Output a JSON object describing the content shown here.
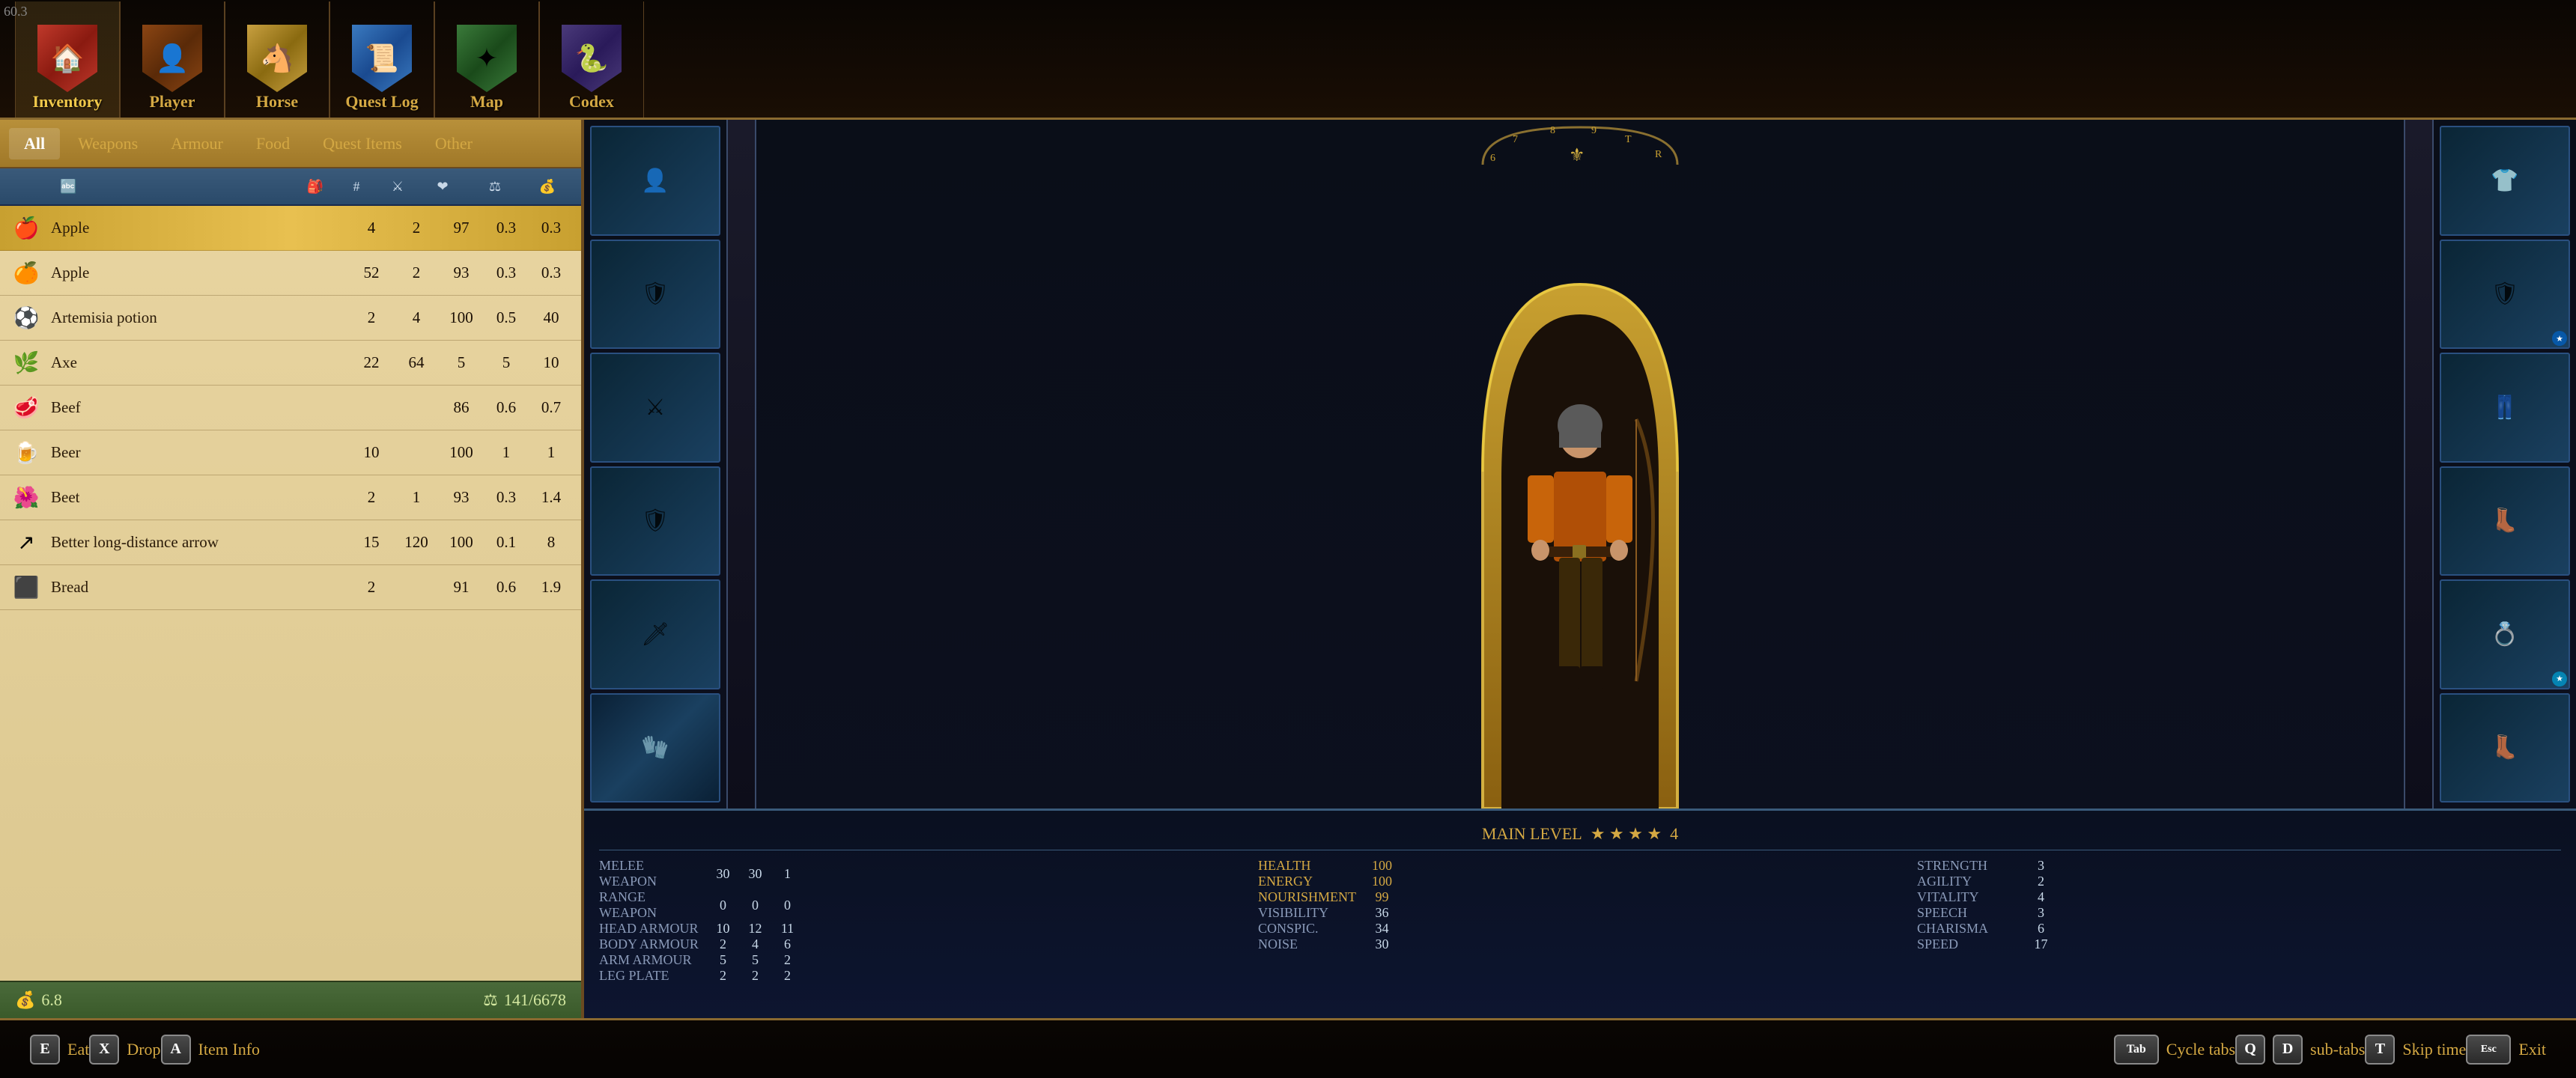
{
  "version": "60.3",
  "nav": {
    "tabs": [
      {
        "id": "inventory",
        "label": "Inventory",
        "icon": "🏠",
        "active": true
      },
      {
        "id": "player",
        "label": "Player",
        "icon": "👤",
        "active": false
      },
      {
        "id": "horse",
        "label": "Horse",
        "icon": "🐴",
        "active": false
      },
      {
        "id": "quest_log",
        "label": "Quest Log",
        "icon": "📜",
        "active": false
      },
      {
        "id": "map",
        "label": "Map",
        "icon": "🗺",
        "active": false
      },
      {
        "id": "codex",
        "label": "Codex",
        "icon": "📖",
        "active": false
      }
    ]
  },
  "inventory": {
    "filter_tabs": [
      {
        "id": "all",
        "label": "All",
        "active": true
      },
      {
        "id": "weapons",
        "label": "Weapons",
        "active": false
      },
      {
        "id": "armour",
        "label": "Armour",
        "active": false
      },
      {
        "id": "food",
        "label": "Food",
        "active": false
      },
      {
        "id": "quest_items",
        "label": "Quest Items",
        "active": false
      },
      {
        "id": "other",
        "label": "Other",
        "active": false
      }
    ],
    "columns": {
      "sort": "AZ",
      "icon": "🎒",
      "qty": "#",
      "type": "⚔",
      "condition": "❤",
      "weight": "⚖",
      "price": "💰"
    },
    "items": [
      {
        "name": "Apple",
        "icon": "🍎",
        "qty": "4",
        "slots": "2",
        "condition": "97",
        "weight": "0.3",
        "price": "0.3",
        "selected": true
      },
      {
        "name": "Apple",
        "icon": "🍎",
        "qty": "52",
        "slots": "2",
        "condition": "93",
        "weight": "0.3",
        "price": "0.3",
        "selected": false
      },
      {
        "name": "Artemisia potion",
        "icon": "🧪",
        "qty": "2",
        "slots": "4",
        "condition": "100",
        "weight": "0.5",
        "price": "40",
        "selected": false
      },
      {
        "name": "Axe",
        "icon": "🪓",
        "qty": "22",
        "slots": "64",
        "condition": "5",
        "weight": "5",
        "price": "10",
        "selected": false
      },
      {
        "name": "Beef",
        "icon": "🥩",
        "qty": "",
        "slots": "",
        "condition": "86",
        "weight": "0.6",
        "price": "0.7",
        "selected": false
      },
      {
        "name": "Beer",
        "icon": "🍺",
        "qty": "10",
        "slots": "",
        "condition": "100",
        "weight": "1",
        "price": "1",
        "selected": false
      },
      {
        "name": "Beet",
        "icon": "🌿",
        "qty": "2",
        "slots": "1",
        "condition": "93",
        "weight": "0.3",
        "price": "1.4",
        "selected": false
      },
      {
        "name": "Better long-distance arrow",
        "icon": "➶",
        "qty": "15",
        "slots": "120",
        "condition": "100",
        "weight": "0.1",
        "price": "8",
        "selected": false
      },
      {
        "name": "Bread",
        "icon": "🍞",
        "qty": "2",
        "slots": "",
        "condition": "91",
        "weight": "0.6",
        "price": "1.9",
        "selected": false
      }
    ],
    "bottom": {
      "gold": "6.8",
      "weight_current": "141",
      "weight_max": "6678"
    }
  },
  "character": {
    "main_level_label": "MAIN LEVEL",
    "main_level_value": "4",
    "stats": [
      {
        "label": "MELEE WEAPON",
        "val1": "30",
        "val2": "30",
        "val3": "1"
      },
      {
        "label": "RANGE WEAPON",
        "val1": "0",
        "val2": "0",
        "val3": "0"
      },
      {
        "label": "HEAD ARMOUR",
        "val1": "10",
        "val2": "12",
        "val3": "11"
      },
      {
        "label": "BODY ARMOUR",
        "val1": "2",
        "val2": "4",
        "val3": "6"
      },
      {
        "label": "ARM ARMOUR",
        "val1": "5",
        "val2": "5",
        "val3": "2"
      },
      {
        "label": "LEG PLATE",
        "val1": "2",
        "val2": "2",
        "val3": "2"
      }
    ],
    "vital_stats": [
      {
        "label": "HEALTH",
        "value": "100",
        "highlight": "yellow"
      },
      {
        "label": "ENERGY",
        "value": "100",
        "highlight": "yellow"
      },
      {
        "label": "NOURISHMENT",
        "value": "99",
        "highlight": "yellow"
      },
      {
        "label": "VISIBILITY",
        "value": "36",
        "highlight": "normal"
      },
      {
        "label": "CONSPIC.",
        "value": "34",
        "highlight": "normal"
      },
      {
        "label": "NOISE",
        "value": "30",
        "highlight": "normal"
      }
    ],
    "attributes": [
      {
        "label": "STRENGTH",
        "value": "3"
      },
      {
        "label": "AGILITY",
        "value": "2"
      },
      {
        "label": "VITALITY",
        "value": "4"
      },
      {
        "label": "SPEECH",
        "value": "3"
      },
      {
        "label": "CHARISMA",
        "value": "6"
      },
      {
        "label": "SPEED",
        "value": "17"
      }
    ],
    "equip_left": [
      {
        "icon": "👤",
        "has_item": true
      },
      {
        "icon": "🛡",
        "has_item": true
      },
      {
        "icon": "⚔",
        "has_item": true
      },
      {
        "icon": "🛡",
        "has_item": true
      },
      {
        "icon": "🗡",
        "has_item": true
      },
      {
        "icon": "🧤",
        "has_item": false
      }
    ],
    "equip_right": [
      {
        "icon": "👕",
        "has_item": true
      },
      {
        "icon": "🛡",
        "has_item": true
      },
      {
        "icon": "👖",
        "has_item": true
      },
      {
        "icon": "👢",
        "has_item": true
      },
      {
        "icon": "🎯",
        "has_item": true
      },
      {
        "icon": "👢",
        "has_item": true
      }
    ]
  },
  "actions": [
    {
      "key": "E",
      "label": "Eat"
    },
    {
      "key": "X",
      "label": "Drop"
    },
    {
      "key": "A",
      "label": "Item Info"
    },
    {
      "key": "Tab",
      "label": "Cycle tabs"
    },
    {
      "key": "Q",
      "label": ""
    },
    {
      "key": "D",
      "label": "sub-tabs"
    },
    {
      "key": "T",
      "label": "Skip time"
    },
    {
      "key": "Esc",
      "label": "Exit"
    }
  ]
}
